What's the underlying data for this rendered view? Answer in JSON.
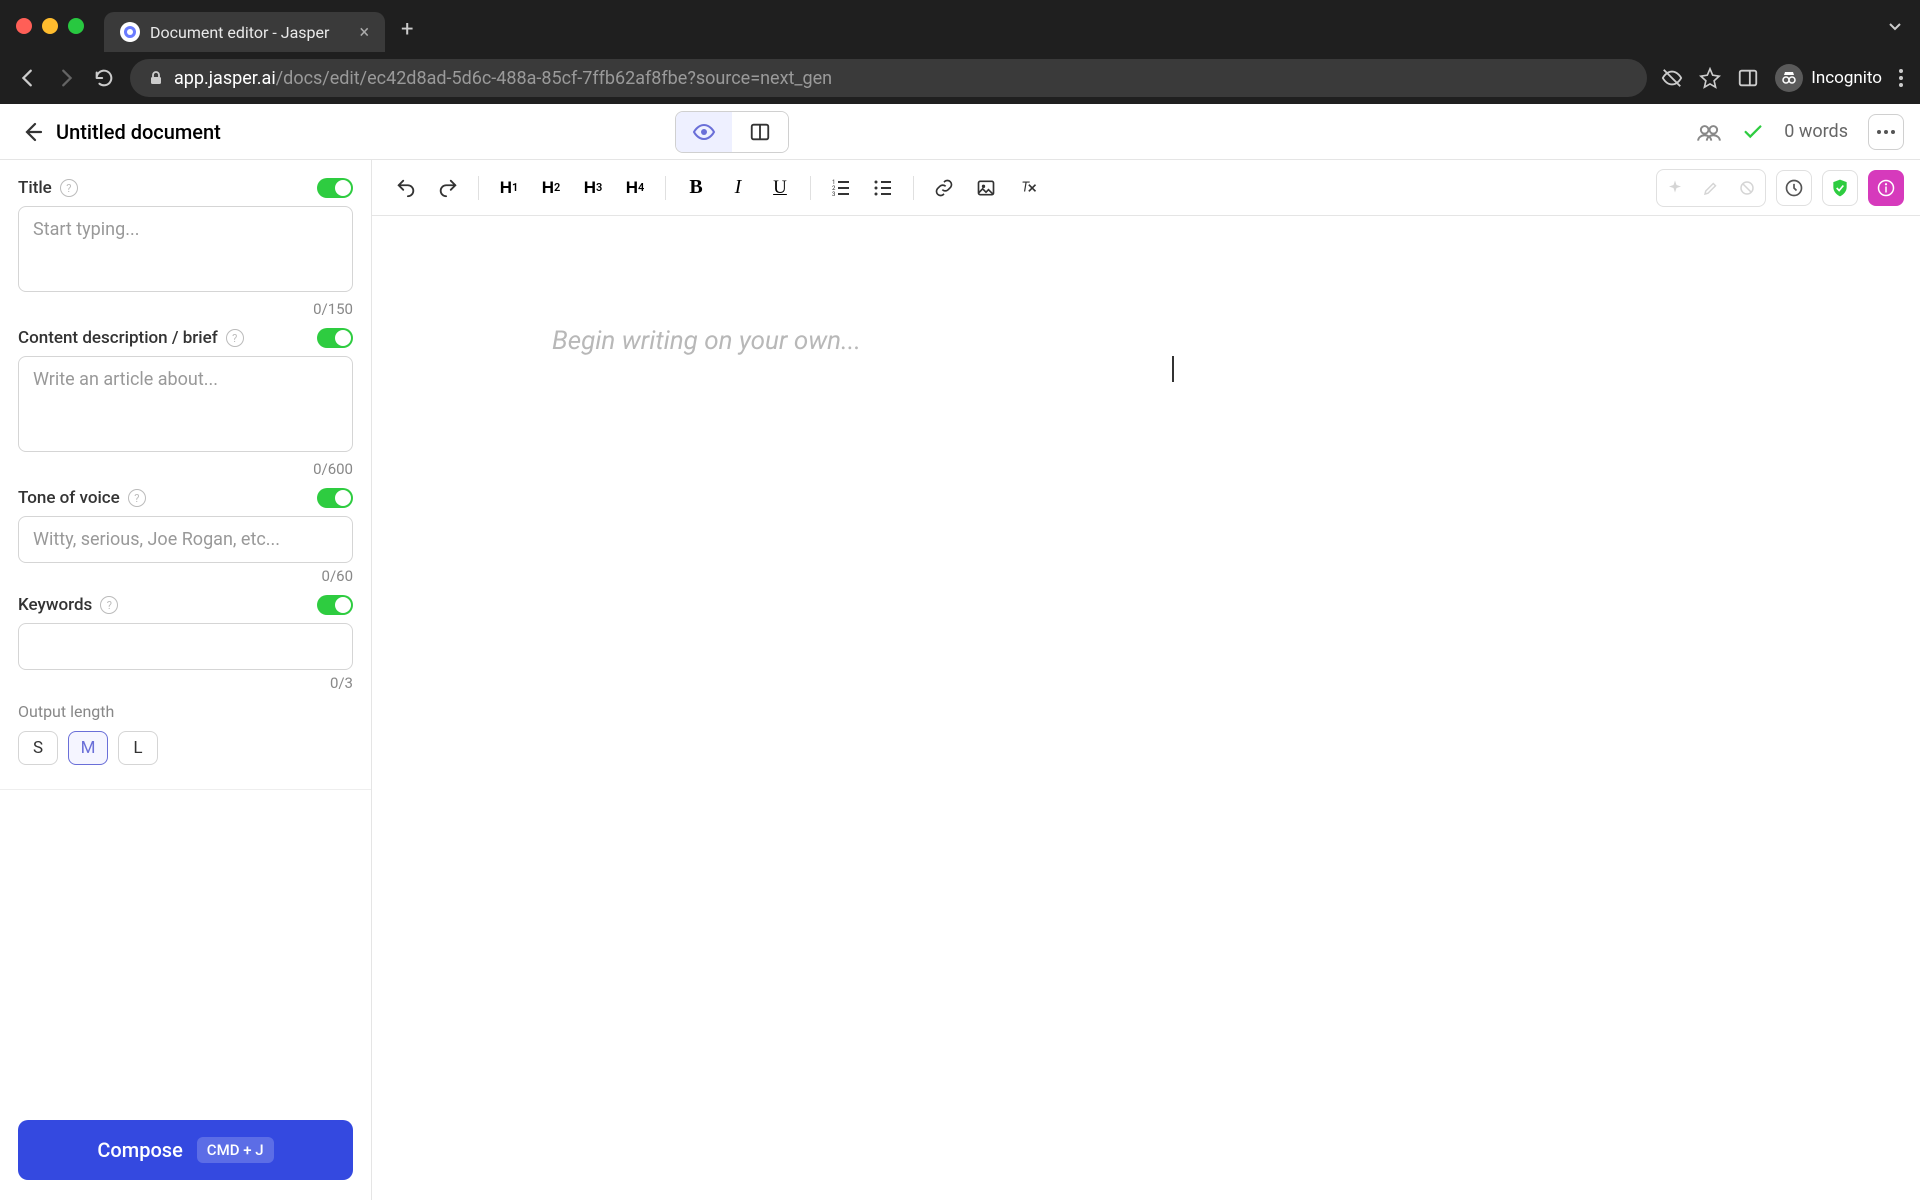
{
  "browser": {
    "tab_title": "Document editor - Jasper",
    "url_domain": "app.jasper.ai",
    "url_path": "/docs/edit/ec42d8ad-5d6c-488a-85cf-7ffb62af8fbe?source=next_gen",
    "incognito_label": "Incognito"
  },
  "header": {
    "doc_title": "Untitled document",
    "word_count": "0 words"
  },
  "sidebar": {
    "title": {
      "label": "Title",
      "placeholder": "Start typing...",
      "count": "0/150"
    },
    "brief": {
      "label": "Content description / brief",
      "placeholder": "Write an article about...",
      "count": "0/600"
    },
    "tone": {
      "label": "Tone of voice",
      "placeholder": "Witty, serious, Joe Rogan, etc...",
      "count": "0/60"
    },
    "keywords": {
      "label": "Keywords",
      "count": "0/3"
    },
    "output_length": {
      "label": "Output length",
      "options": [
        "S",
        "M",
        "L"
      ],
      "selected": "M"
    },
    "compose": {
      "label": "Compose",
      "shortcut": "CMD + J"
    }
  },
  "editor": {
    "placeholder": "Begin writing on your own..."
  }
}
